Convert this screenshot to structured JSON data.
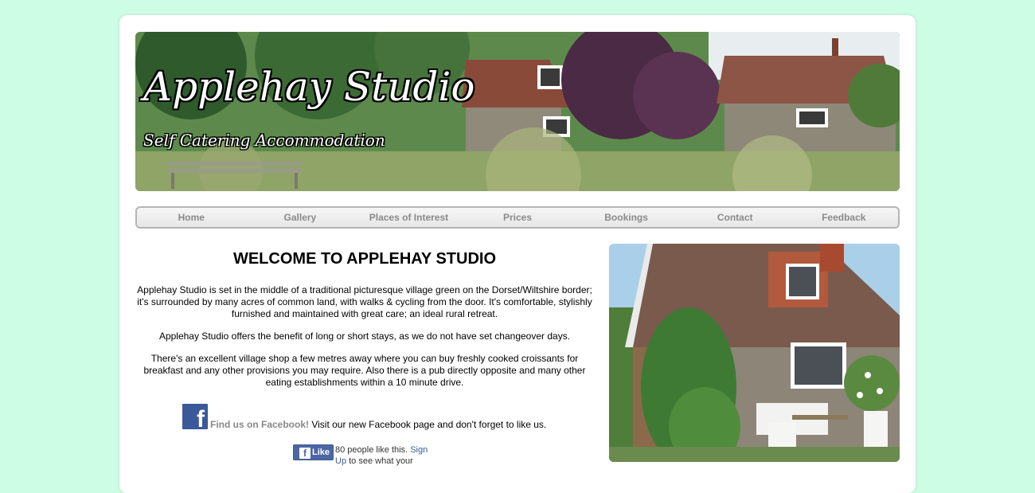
{
  "banner": {
    "title": "Applehay Studio",
    "subtitle": "Self Catering Accommodation"
  },
  "nav": {
    "items": [
      "Home",
      "Gallery",
      "Places of Interest",
      "Prices",
      "Bookings",
      "Contact",
      "Feedback"
    ]
  },
  "main": {
    "heading": "WELCOME TO APPLEHAY STUDIO",
    "paragraphs": [
      "Applehay Studio is set in the middle of a traditional picturesque village green on the Dorset/Wiltshire border; it's surrounded by many acres of common land, with walks & cycling from the door. It's comfortable, stylishly furnished and maintained with great care; an ideal rural retreat.",
      "Applehay Studio offers the benefit of long or short stays, as we do not have set changeover days.",
      "There's an excellent village shop a few metres away where you can buy freshly cooked croissants for breakfast and any other provisions you may require. Also there is a pub directly opposite and many other eating establishments within a 10 minute drive."
    ],
    "facebook": {
      "icon": "facebook-f-icon",
      "link_text": "Find us on Facebook!",
      "text": " Visit our new Facebook page and don't forget to like us."
    },
    "like": {
      "button_label": "Like",
      "count_text": "80 people like this.",
      "sign_up": "Sign Up",
      "tail": "to see what your"
    }
  },
  "colors": {
    "background": "#cdfde5",
    "page": "#ffffff",
    "nav_text": "#8a8a8a",
    "facebook_blue": "#3b5998"
  }
}
